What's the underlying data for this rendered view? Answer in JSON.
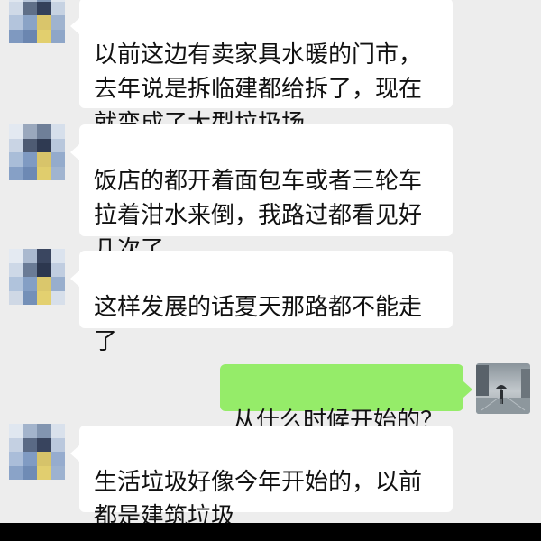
{
  "messages": [
    {
      "direction": "in",
      "text": "以前这边有卖家具水暖的门市，\n去年说是拆临建都给拆了，现在\n就变成了大型垃圾场"
    },
    {
      "direction": "in",
      "text": "饭店的都开着面包车或者三轮车\n拉着泔水来倒，我路过都看见好\n几次了"
    },
    {
      "direction": "in",
      "text": "这样发展的话夏天那路都不能走\n了"
    },
    {
      "direction": "out",
      "text": "从什么时候开始的？"
    },
    {
      "direction": "in",
      "text": "生活垃圾好像今年开始的，以前\n都是建筑垃圾"
    }
  ],
  "avatars": {
    "contact_icon": "pixelated-avatar",
    "self_icon": "rainy-street-photo-avatar"
  },
  "colors": {
    "chat_background": "#ededed",
    "incoming_bubble": "#ffffff",
    "outgoing_bubble": "#95ec69",
    "text": "#111111"
  }
}
